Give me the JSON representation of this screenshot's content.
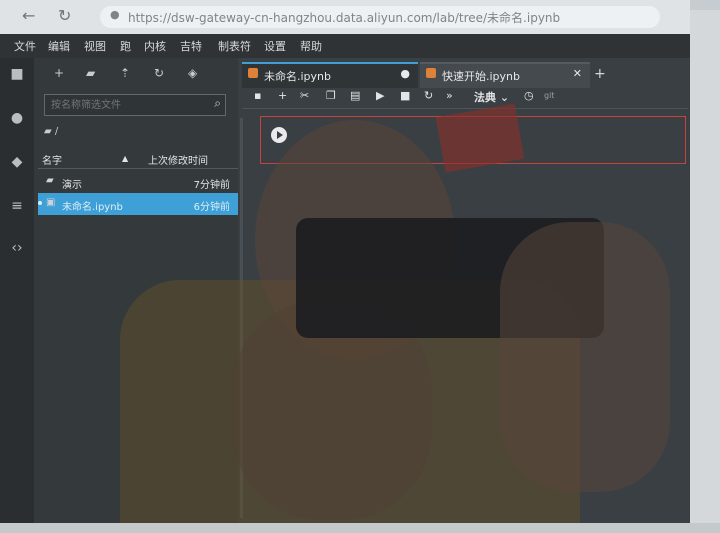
{
  "browser": {
    "url": "https://dsw-gateway-cn-hangzhou.data.aliyun.com",
    "url_suffix": "/lab/tree/未命名.ipynb"
  },
  "menu": [
    "文件",
    "编辑",
    "视图",
    "跑",
    "内核",
    "吉特",
    "制表符",
    "设置",
    "帮助"
  ],
  "file_browser": {
    "filter_placeholder": "按名称筛选文件",
    "breadcrumb": "/",
    "col_name": "名字",
    "col_modified": "上次修改时间",
    "rows": [
      {
        "name": "演示",
        "time": "7分钟前",
        "type": "folder"
      },
      {
        "name": "未命名.ipynb",
        "time": "6分钟前",
        "type": "notebook"
      }
    ]
  },
  "tabs": [
    {
      "label": "未命名.ipynb",
      "active": true
    },
    {
      "label": "快速开始.ipynb",
      "active": false
    }
  ],
  "notebook": {
    "kernel": "法典",
    "git_label": "git"
  },
  "colors": {
    "accent": "#3ea0d6",
    "cell_border": "#c8423d",
    "notebook_icon": "#e0813a"
  }
}
